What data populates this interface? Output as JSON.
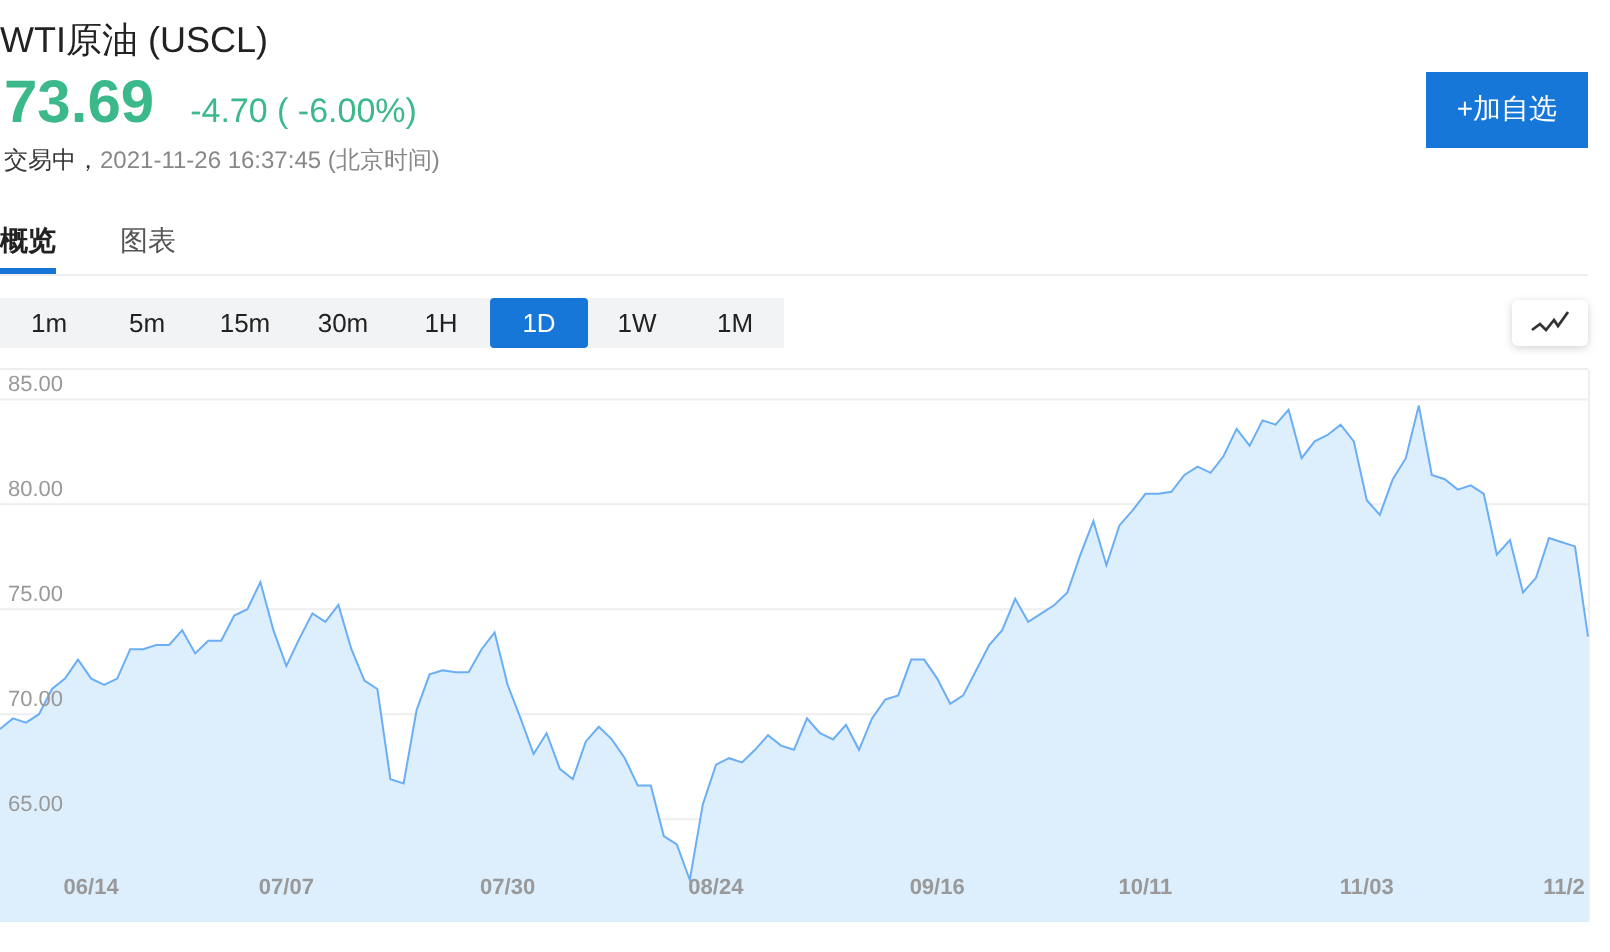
{
  "header": {
    "title": "WTI原油 (USCL)",
    "price": "73.69",
    "change": "-4.70 ( -6.00%)",
    "status": "交易中，",
    "time": "2021-11-26 16:37:45 (北京时间)",
    "watch_button": "+加自选"
  },
  "tabs": [
    {
      "label": "概览",
      "selected": true
    },
    {
      "label": "图表",
      "selected": false
    }
  ],
  "periods": [
    {
      "label": "1m",
      "selected": false
    },
    {
      "label": "5m",
      "selected": false
    },
    {
      "label": "15m",
      "selected": false
    },
    {
      "label": "30m",
      "selected": false
    },
    {
      "label": "1H",
      "selected": false
    },
    {
      "label": "1D",
      "selected": true
    },
    {
      "label": "1W",
      "selected": false
    },
    {
      "label": "1M",
      "selected": false
    }
  ],
  "chart": {
    "chart_data": {
      "type": "area",
      "grid": true,
      "ylim": [
        60.1,
        86.4
      ],
      "yticks": [
        {
          "value": 85,
          "label": "85.00"
        },
        {
          "value": 80,
          "label": "80.00"
        },
        {
          "value": 75,
          "label": "75.00"
        },
        {
          "value": 70,
          "label": "70.00"
        },
        {
          "value": 65,
          "label": "65.00"
        }
      ],
      "categories": [
        null,
        null,
        null,
        null,
        null,
        null,
        null,
        "06/14",
        null,
        null,
        null,
        null,
        null,
        null,
        null,
        null,
        null,
        null,
        null,
        null,
        null,
        null,
        "07/07",
        null,
        null,
        null,
        null,
        null,
        null,
        null,
        null,
        null,
        null,
        null,
        null,
        null,
        null,
        null,
        null,
        "07/30",
        null,
        null,
        null,
        null,
        null,
        null,
        null,
        null,
        null,
        null,
        null,
        null,
        null,
        null,
        null,
        "08/24",
        null,
        null,
        null,
        null,
        null,
        null,
        null,
        null,
        null,
        null,
        null,
        null,
        null,
        null,
        null,
        null,
        "09/16",
        null,
        null,
        null,
        null,
        null,
        null,
        null,
        null,
        null,
        null,
        null,
        null,
        null,
        null,
        null,
        "10/11",
        null,
        null,
        null,
        null,
        null,
        null,
        null,
        null,
        null,
        null,
        null,
        null,
        null,
        null,
        null,
        null,
        "11/03",
        null,
        null,
        null,
        null,
        null,
        null,
        null,
        null,
        null,
        null,
        null,
        null,
        null,
        null,
        null,
        "11/2",
        null
      ],
      "series": [
        {
          "color": "#6aaef5",
          "values": [
            69.3,
            69.8,
            69.6,
            70.0,
            71.2,
            71.7,
            72.6,
            71.7,
            71.4,
            71.7,
            73.1,
            73.1,
            73.3,
            73.3,
            74.0,
            72.9,
            73.5,
            73.5,
            74.7,
            75.0,
            76.3,
            74.0,
            72.3,
            73.6,
            74.8,
            74.4,
            75.2,
            73.1,
            71.6,
            71.2,
            66.9,
            66.7,
            70.2,
            71.9,
            72.1,
            72.0,
            72.0,
            73.1,
            73.9,
            71.4,
            69.8,
            68.1,
            69.1,
            67.4,
            66.9,
            68.7,
            69.4,
            68.8,
            67.9,
            66.6,
            66.6,
            64.2,
            63.8,
            62.1,
            65.7,
            67.6,
            67.9,
            67.7,
            68.3,
            69.0,
            68.5,
            68.3,
            69.8,
            69.1,
            68.8,
            69.5,
            68.3,
            69.8,
            70.7,
            70.9,
            72.6,
            72.6,
            71.7,
            70.5,
            70.9,
            72.1,
            73.3,
            74.0,
            75.5,
            74.4,
            74.8,
            75.2,
            75.8,
            77.6,
            79.2,
            77.1,
            79.0,
            79.7,
            80.5,
            80.5,
            80.6,
            81.4,
            81.8,
            81.5,
            82.3,
            83.6,
            82.8,
            84.0,
            83.8,
            84.5,
            82.2,
            83.0,
            83.3,
            83.8,
            83.0,
            80.2,
            79.5,
            81.2,
            82.2,
            84.7,
            81.4,
            81.2,
            80.7,
            80.9,
            80.5,
            77.6,
            78.3,
            75.8,
            76.5,
            78.4,
            78.2,
            78.0,
            73.7
          ]
        }
      ]
    }
  }
}
